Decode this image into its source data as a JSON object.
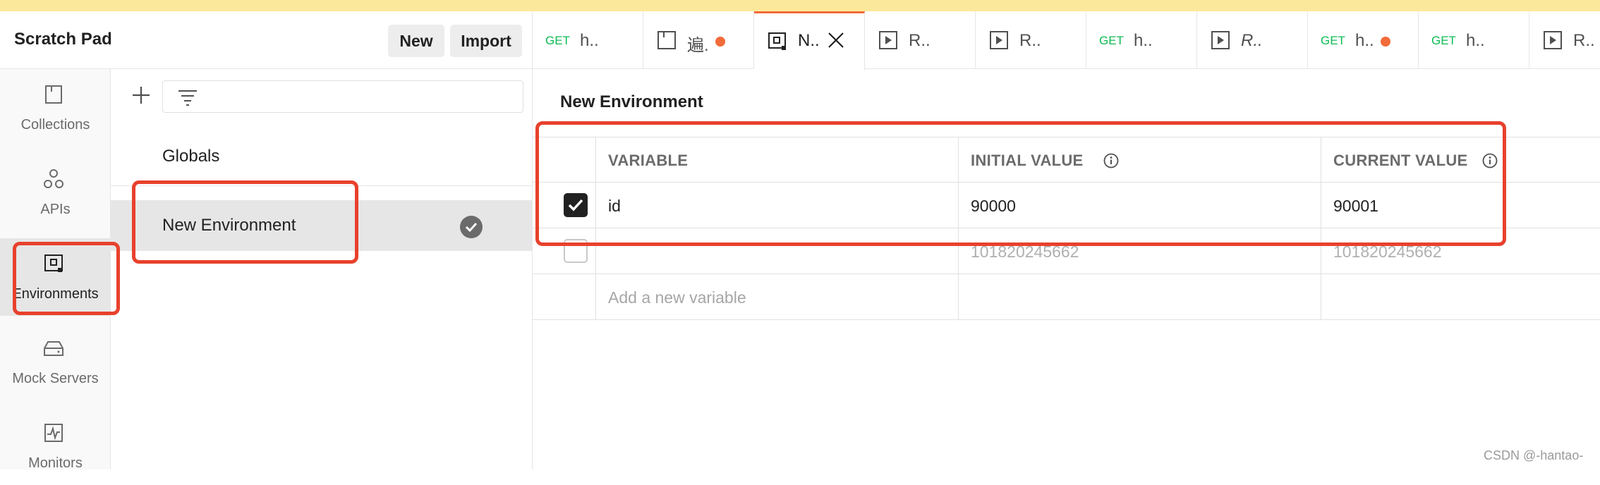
{
  "header": {
    "title": "Scratch Pad",
    "new_label": "New",
    "import_label": "Import"
  },
  "rail": [
    {
      "label": "Collections",
      "icon": "collections-icon"
    },
    {
      "label": "APIs",
      "icon": "apis-icon"
    },
    {
      "label": "Environments",
      "icon": "environments-icon",
      "active": true
    },
    {
      "label": "Mock Servers",
      "icon": "mock-servers-icon"
    },
    {
      "label": "Monitors",
      "icon": "monitors-icon"
    }
  ],
  "environments": {
    "globals": "Globals",
    "selected": "New Environment"
  },
  "tabs": [
    {
      "method": "GET",
      "title": "h.."
    },
    {
      "title": "遍.",
      "icon": "collection-icon",
      "unsaved": true
    },
    {
      "title": "N..",
      "icon": "environment-icon",
      "active": true
    },
    {
      "title": "R..",
      "icon": "runner-icon"
    },
    {
      "title": "R..",
      "icon": "runner-icon"
    },
    {
      "method": "GET",
      "title": "h.."
    },
    {
      "title": "R..",
      "icon": "runner-icon"
    },
    {
      "method": "GET",
      "title": "h..",
      "unsaved": true
    },
    {
      "method": "GET",
      "title": "h.."
    },
    {
      "title": "R..",
      "icon": "runner-icon"
    }
  ],
  "main": {
    "title": "New Environment",
    "columns": {
      "variable": "VARIABLE",
      "initial": "INITIAL VALUE",
      "current": "CURRENT VALUE"
    },
    "rows": [
      {
        "checked": true,
        "variable": "id",
        "initial": "90000",
        "current": "90001"
      },
      {
        "checked": false,
        "variable": "",
        "initial": "101820245662",
        "current": "101820245662"
      }
    ],
    "add_placeholder": "Add a new variable"
  },
  "colors": {
    "accent": "#f26b3a",
    "highlight": "#e8412c",
    "get": "#0cbb52"
  },
  "watermark": "CSDN @-hantao-"
}
